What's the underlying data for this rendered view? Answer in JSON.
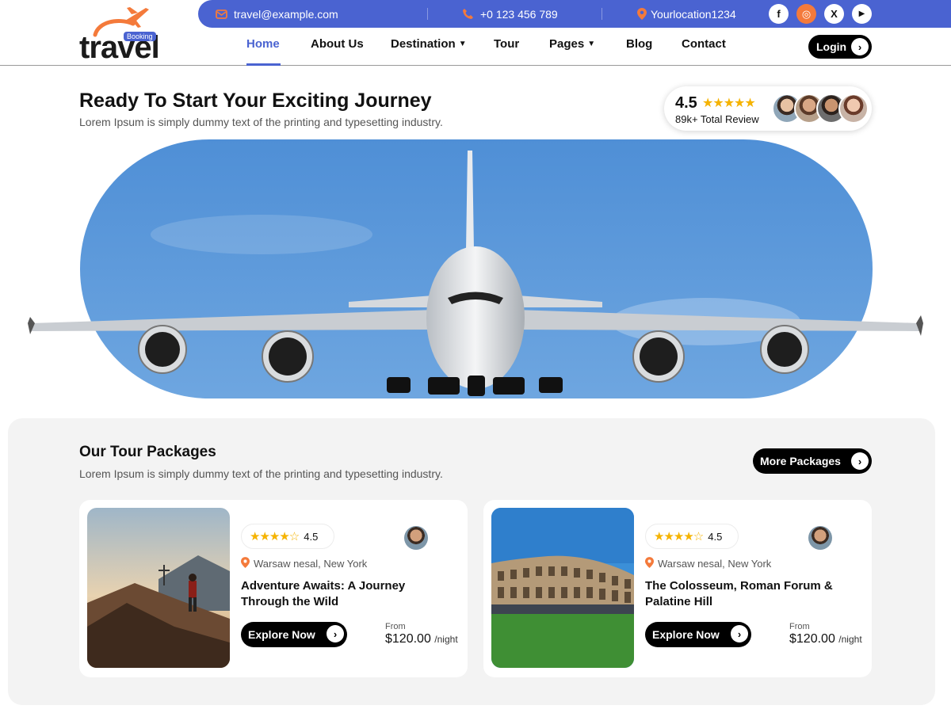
{
  "topbar": {
    "email": "travel@example.com",
    "phone": "+0 123 456 789",
    "location": "Yourlocation1234",
    "social": [
      {
        "icon": "facebook-icon",
        "glyph": "f"
      },
      {
        "icon": "instagram-icon",
        "glyph": "◎"
      },
      {
        "icon": "x-icon",
        "glyph": "X"
      },
      {
        "icon": "youtube-icon",
        "glyph": "▶"
      }
    ]
  },
  "logo": {
    "word": "travel",
    "badge": "Booking"
  },
  "nav": {
    "items": [
      "Home",
      "About Us",
      "Destination",
      "Tour",
      "Pages",
      "Blog",
      "Contact"
    ],
    "active": "Home",
    "login": "Login"
  },
  "hero": {
    "title": "Ready To Start Your Exciting Journey",
    "subtitle": "Lorem Ipsum is simply dummy text of the printing and typesetting industry.",
    "rating": "4.5",
    "stars": "★★★★★",
    "reviews": "89k+ Total Review"
  },
  "packages": {
    "title": "Our Tour Packages",
    "subtitle": "Lorem Ipsum is simply dummy text of the printing and typesetting industry.",
    "more_button": "More Packages",
    "cards": [
      {
        "rating": "4.5",
        "stars": "★★★★☆",
        "location": "Warsaw nesal, New York",
        "title": "Adventure Awaits: A Journey Through the Wild",
        "button": "Explore Now",
        "from_label": "From",
        "price": "$120.00",
        "unit": "/night"
      },
      {
        "rating": "4.5",
        "stars": "★★★★☆",
        "location": "Warsaw nesal, New York",
        "title": "The Colosseum, Roman Forum & Palatine Hill",
        "button": "Explore Now",
        "from_label": "From",
        "price": "$120.00",
        "unit": "/night"
      }
    ]
  },
  "colors": {
    "brand_blue": "#4a63d1",
    "accent_orange": "#f47a3b",
    "star_gold": "#f5b301"
  }
}
